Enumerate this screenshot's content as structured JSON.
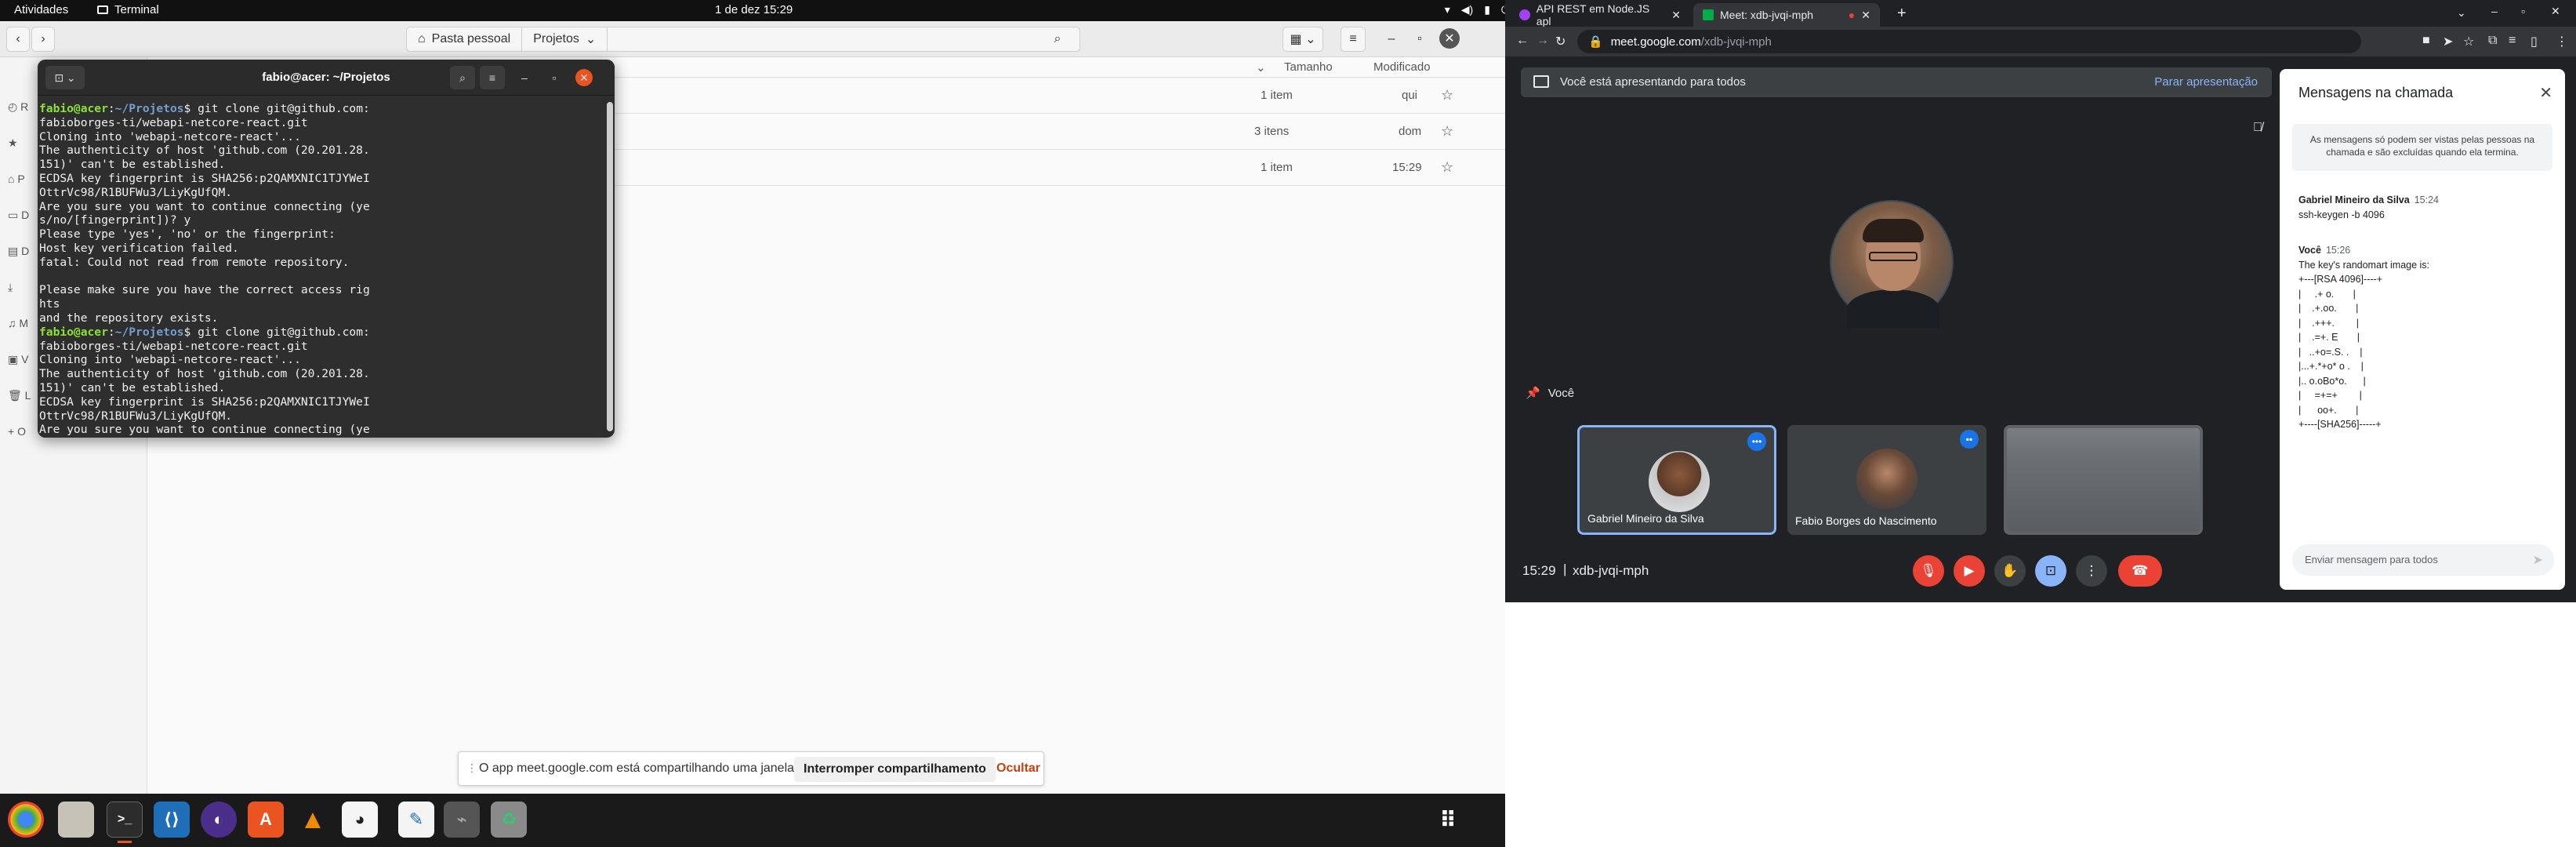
{
  "topbar": {
    "activities": "Atividades",
    "app_name": "Terminal",
    "clock": "1 de dez  15:29"
  },
  "files": {
    "path_segments": [
      "Pasta pessoal",
      "Projetos"
    ],
    "columns": {
      "size": "Tamanho",
      "modified": "Modificado"
    },
    "rows": [
      {
        "size": "1 item",
        "modified": "qui"
      },
      {
        "size": "3 itens",
        "modified": "dom"
      },
      {
        "size": "1 item",
        "modified": "15:29"
      }
    ],
    "sidebar_letters": [
      "R",
      "P",
      "D",
      "D",
      "M",
      "V",
      "L",
      "O"
    ]
  },
  "terminal": {
    "title": "fabio@acer: ~/Projetos",
    "user": "fabio@acer",
    "path": "~/Projetos",
    "sessions": [
      {
        "command": "git clone git@github.com:fabioborges-ti/webapi-netcore-react.git",
        "output": [
          "Cloning into 'webapi-netcore-react'...",
          "The authenticity of host 'github.com (20.201.28.151)' can't be established.",
          "ECDSA key fingerprint is SHA256:p2QAMXNIC1TJYWeIOttrVc98/R1BUFWu3/LiyKgUfQM.",
          "Are you sure you want to continue connecting (yes/no/[fingerprint])? y",
          "Please type 'yes', 'no' or the fingerprint:",
          "Host key verification failed.",
          "fatal: Could not read from remote repository.",
          "",
          "Please make sure you have the correct access rights",
          "and the repository exists."
        ]
      },
      {
        "command": "git clone git@github.com:fabioborges-ti/webapi-netcore-react.git",
        "output": [
          "Cloning into 'webapi-netcore-react'...",
          "The authenticity of host 'github.com (20.201.28.151)' can't be established.",
          "ECDSA key fingerprint is SHA256:p2QAMXNIC1TJYWeIOttrVc98/R1BUFWu3/LiyKgUfQM.",
          "Are you sure you want to continue connecting (yes/no/[fingerprint])?"
        ]
      }
    ]
  },
  "share_notice": {
    "message": "O app meet.google.com está compartilhando uma janela.",
    "stop_label": "Interromper compartilhamento",
    "hide_label": "Ocultar"
  },
  "chrome": {
    "tabs": [
      {
        "title": "API REST em Node.JS apl"
      },
      {
        "title": "Meet: xdb-jvqi-mph"
      }
    ],
    "url_host": "meet.google.com",
    "url_path": "/xdb-jvqi-mph"
  },
  "meet": {
    "banner_text": "Você está apresentando para todos",
    "banner_stop": "Parar apresentação",
    "self_label": "Você",
    "participants": [
      {
        "name": "Gabriel Mineiro da Silva"
      },
      {
        "name": "Fabio Borges do Nascimento"
      }
    ],
    "time": "15:29",
    "meeting_code": "xdb-jvqi-mph",
    "participant_count": "4"
  },
  "chat": {
    "title": "Mensagens na chamada",
    "info": "As mensagens só podem ser vistas pelas pessoas na chamada e são excluídas quando ela termina.",
    "messages": [
      {
        "sender": "Gabriel Mineiro da Silva",
        "time": "15:24",
        "text": "ssh-keygen -b 4096"
      },
      {
        "sender": "Você",
        "time": "15:26",
        "text": "The key's randomart image is:\n+---[RSA 4096]----+\n|     .+ o.       |\n|    .+.oo.       |\n|    .+++.        |\n|    .=+. E       |\n|   ..+o=.S. .    |\n|...+.*+o* o .    |\n|.. o.oBo*o.      |\n|     =+=+        |\n|      oo+.       |\n+----[SHA256]-----+"
      }
    ],
    "input_placeholder": "Enviar mensagem para todos"
  }
}
